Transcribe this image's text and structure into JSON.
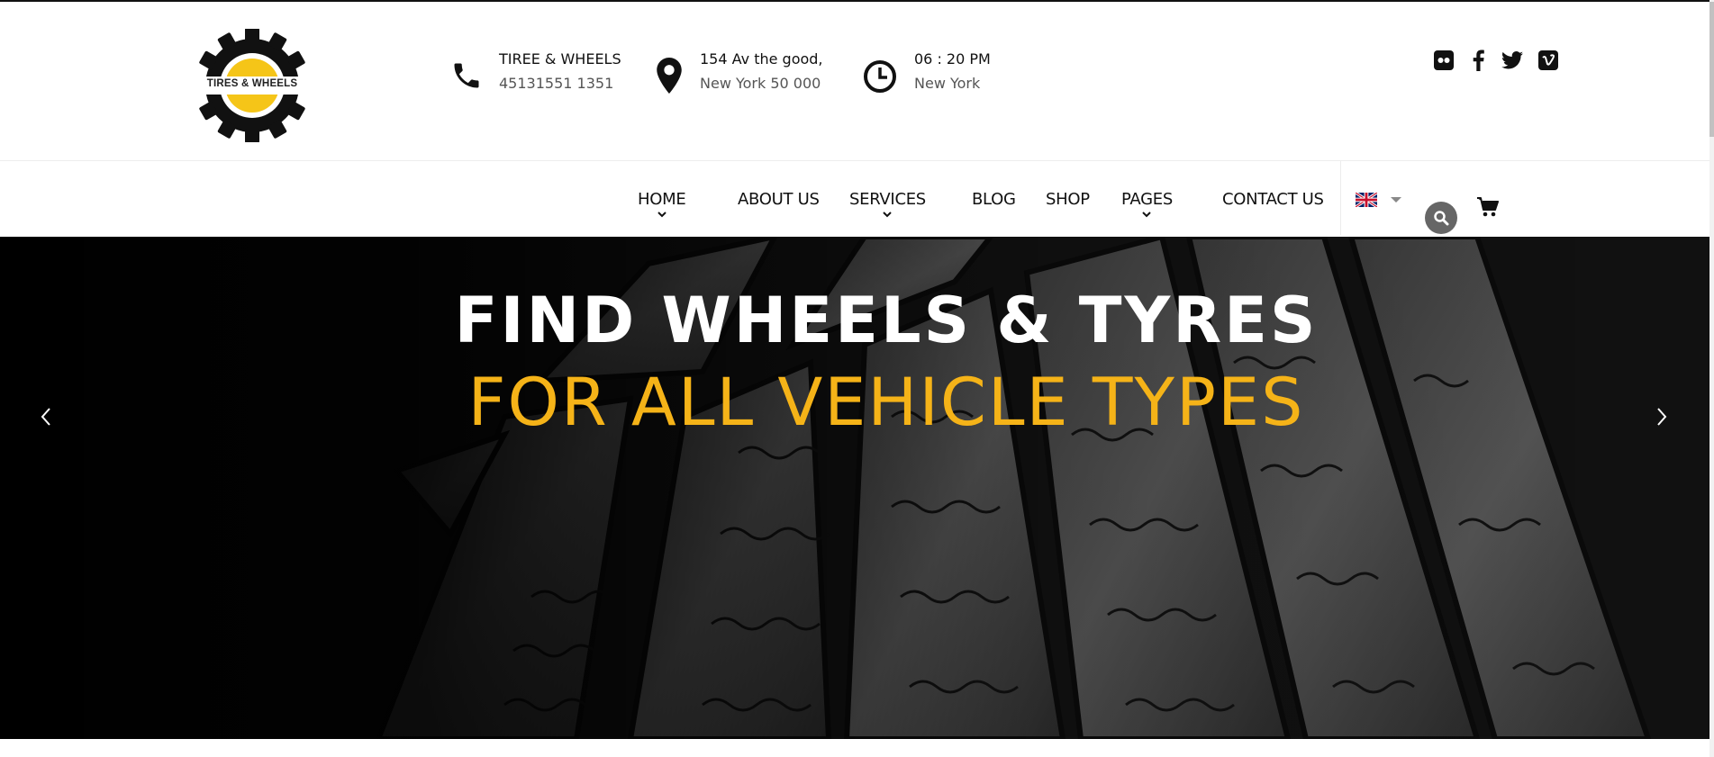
{
  "logo": {
    "text": "TIRES & WHEELS",
    "accent": "#f5c518"
  },
  "contact": {
    "phone": {
      "icon": "phone-icon",
      "line1": "TIREE & WHEELS",
      "line2": "45131551 1351"
    },
    "address": {
      "icon": "map-pin-icon",
      "line1": "154 Av the good,",
      "line2": "New York 50 000"
    },
    "hours": {
      "icon": "clock-icon",
      "line1": "06 : 20 PM",
      "line2": "New York"
    }
  },
  "social": [
    "flickr-icon",
    "facebook-icon",
    "twitter-icon",
    "vimeo-icon"
  ],
  "nav": {
    "items": [
      {
        "label": "HOME",
        "has_dropdown": true
      },
      {
        "label": "ABOUT US",
        "has_dropdown": false
      },
      {
        "label": "SERVICES",
        "has_dropdown": true
      },
      {
        "label": "BLOG",
        "has_dropdown": false
      },
      {
        "label": "SHOP",
        "has_dropdown": false
      },
      {
        "label": "PAGES",
        "has_dropdown": true
      },
      {
        "label": "CONTACT US",
        "has_dropdown": false
      }
    ],
    "language_icon": "uk-flag-icon",
    "search_icon": "search-icon",
    "cart_icon": "cart-icon"
  },
  "hero": {
    "title": "FIND WHEELS & TYRES",
    "subtitle": "FOR ALL VEHICLE TYPES",
    "title_color": "#ffffff",
    "subtitle_color": "#f5b318",
    "prev_icon": "chevron-left-icon",
    "next_icon": "chevron-right-icon"
  }
}
